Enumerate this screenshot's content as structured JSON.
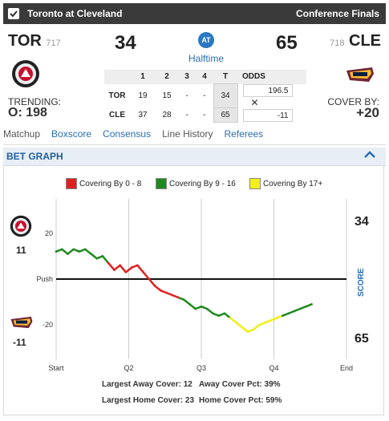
{
  "header": {
    "matchup": "Toronto at Cleveland",
    "round": "Conference Finals"
  },
  "away": {
    "abbr": "TOR",
    "number": "717",
    "score": "34",
    "q1": "19",
    "q2": "15",
    "q3": "-",
    "q4": "-",
    "total": "34",
    "odds": "196.5",
    "trending_label": "TRENDING:",
    "trending": "O: 198"
  },
  "home": {
    "abbr": "CLE",
    "number": "718",
    "score": "65",
    "q1": "37",
    "q2": "28",
    "q3": "-",
    "q4": "-",
    "total": "65",
    "odds": "-11",
    "cover_label": "COVER BY:",
    "cover": "+20"
  },
  "at_label": "AT",
  "status": "Halftime",
  "linescore_headers": [
    "",
    "1",
    "2",
    "3",
    "4",
    "T",
    "ODDS"
  ],
  "close_symbol": "✕",
  "tabs": [
    "Matchup",
    "Boxscore",
    "Consensus",
    "Line History",
    "Referees"
  ],
  "bet_graph": {
    "title": "BET GRAPH",
    "legend": [
      {
        "label": "Covering By 0 - 8",
        "color": "#e02020"
      },
      {
        "label": "Covering By 9 - 16",
        "color": "#1f8a1f"
      },
      {
        "label": "Covering By 17+",
        "color": "#f2ef1a"
      }
    ],
    "away_side_value": "11",
    "home_side_value": "-11",
    "away_score": "34",
    "home_score": "65",
    "score_label": "SCORE",
    "accent": "#2b6fb4"
  },
  "chart_data": {
    "type": "line",
    "x_ticks": [
      "Start",
      "Q2",
      "Q3",
      "Q4",
      "End"
    ],
    "y_ticks": [
      20,
      "Push",
      -20
    ],
    "ylim": [
      -35,
      35
    ],
    "series": [
      {
        "values": [
          [
            0.0,
            12
          ],
          [
            0.02,
            13
          ],
          [
            0.04,
            11
          ],
          [
            0.06,
            13
          ],
          [
            0.08,
            12
          ],
          [
            0.1,
            13
          ],
          [
            0.12,
            11
          ],
          [
            0.14,
            9
          ],
          [
            0.16,
            10
          ],
          [
            0.18,
            7
          ],
          [
            0.2,
            4
          ],
          [
            0.22,
            6
          ],
          [
            0.24,
            3
          ],
          [
            0.26,
            5
          ],
          [
            0.28,
            6
          ],
          [
            0.3,
            3
          ],
          [
            0.32,
            0
          ],
          [
            0.34,
            -3
          ],
          [
            0.36,
            -5
          ],
          [
            0.38,
            -6
          ],
          [
            0.4,
            -7
          ],
          [
            0.42,
            -8
          ],
          [
            0.44,
            -9
          ],
          [
            0.46,
            -11
          ],
          [
            0.48,
            -13
          ],
          [
            0.5,
            -12
          ],
          [
            0.52,
            -13
          ],
          [
            0.54,
            -15
          ],
          [
            0.56,
            -16
          ],
          [
            0.58,
            -15
          ],
          [
            0.6,
            -17
          ],
          [
            0.62,
            -19
          ],
          [
            0.64,
            -21
          ],
          [
            0.66,
            -23
          ],
          [
            0.68,
            -22
          ],
          [
            0.7,
            -20
          ],
          [
            0.72,
            -19
          ],
          [
            0.74,
            -18
          ],
          [
            0.76,
            -17
          ],
          [
            0.78,
            -16
          ],
          [
            0.8,
            -15
          ],
          [
            0.82,
            -14
          ],
          [
            0.84,
            -13
          ],
          [
            0.86,
            -12
          ],
          [
            0.88,
            -11
          ]
        ]
      }
    ],
    "largest_away_cover": {
      "label": "Largest Away Cover:",
      "value": "12"
    },
    "away_cover_pct": {
      "label": "Away Cover Pct:",
      "value": "39%"
    },
    "largest_home_cover": {
      "label": "Largest Home Cover:",
      "value": "23"
    },
    "home_cover_pct": {
      "label": "Home Cover Pct:",
      "value": "59%"
    }
  }
}
